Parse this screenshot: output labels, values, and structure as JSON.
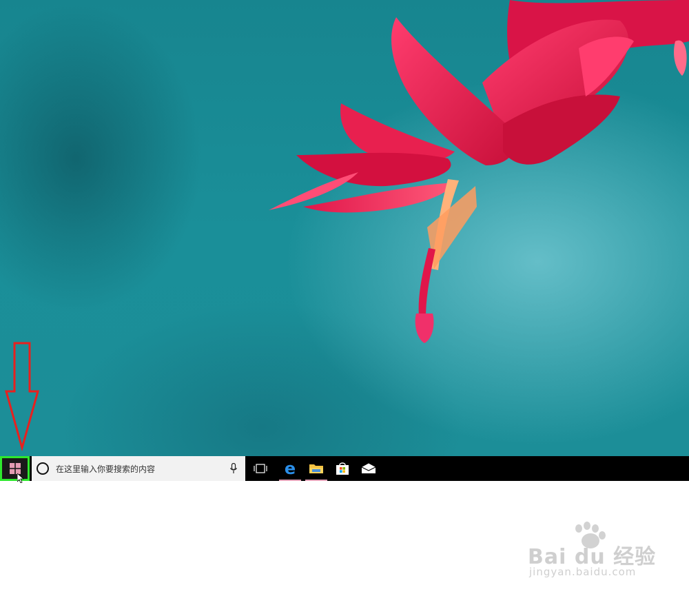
{
  "taskbar": {
    "search_placeholder": "在这里输入你要搜索的内容",
    "start_highlight_color": "#2ee82e",
    "pinned_icons": [
      "task-view-icon",
      "edge-icon",
      "file-explorer-icon",
      "store-icon",
      "mail-icon"
    ]
  },
  "annotation": {
    "arrow_color": "#e8201e"
  },
  "watermark": {
    "brand": "Bai du 经验",
    "url": "jingyan.baidu.com"
  }
}
